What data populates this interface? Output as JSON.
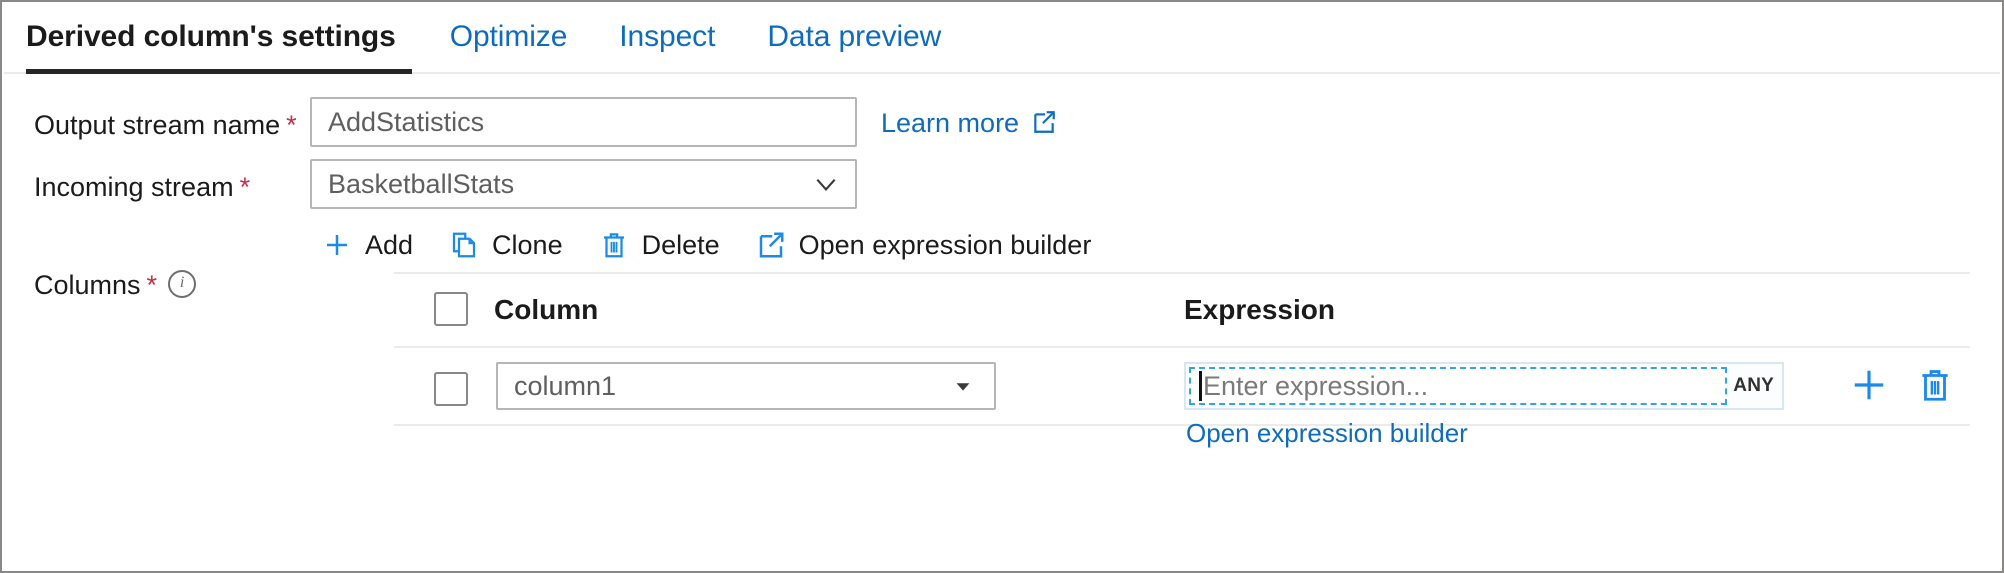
{
  "window": {
    "accent_blue": "#0f6cbd",
    "icon_blue": "#1b8ae8",
    "required_red": "#c4314b",
    "active_tab_underline": "#262626"
  },
  "tabs": [
    {
      "label": "Derived column's settings",
      "active": true
    },
    {
      "label": "Optimize",
      "active": false
    },
    {
      "label": "Inspect",
      "active": false
    },
    {
      "label": "Data preview",
      "active": false
    }
  ],
  "form": {
    "output_stream": {
      "label": "Output stream name",
      "required_marker": "*",
      "value": "AddStatistics",
      "placeholder": "Output stream name"
    },
    "incoming_stream": {
      "label": "Incoming stream",
      "required_marker": "*",
      "value": "BasketballStats",
      "chevron_icon": "chevron-down-icon"
    },
    "learn_more": {
      "label": "Learn more",
      "icon": "external-link-icon"
    },
    "columns": {
      "label": "Columns",
      "required_marker": "*",
      "info_icon": "info-icon"
    }
  },
  "toolbar": {
    "add": {
      "label": "Add",
      "icon": "plus-icon"
    },
    "clone": {
      "label": "Clone",
      "icon": "copy-icon"
    },
    "delete": {
      "label": "Delete",
      "icon": "trash-icon"
    },
    "open_expression_builder": {
      "label": "Open expression builder",
      "icon": "external-link-icon"
    }
  },
  "table": {
    "headers": {
      "select_all": "",
      "column": "Column",
      "expression": "Expression"
    },
    "rows": [
      {
        "selected": false,
        "column_value": "column1",
        "column_caret_icon": "caret-down-icon",
        "expression_value": "",
        "expression_placeholder": "Enter expression...",
        "type_badge": "ANY",
        "sub_link": "Open expression builder",
        "add_row_icon": "plus-icon",
        "delete_row_icon": "trash-icon"
      }
    ]
  }
}
